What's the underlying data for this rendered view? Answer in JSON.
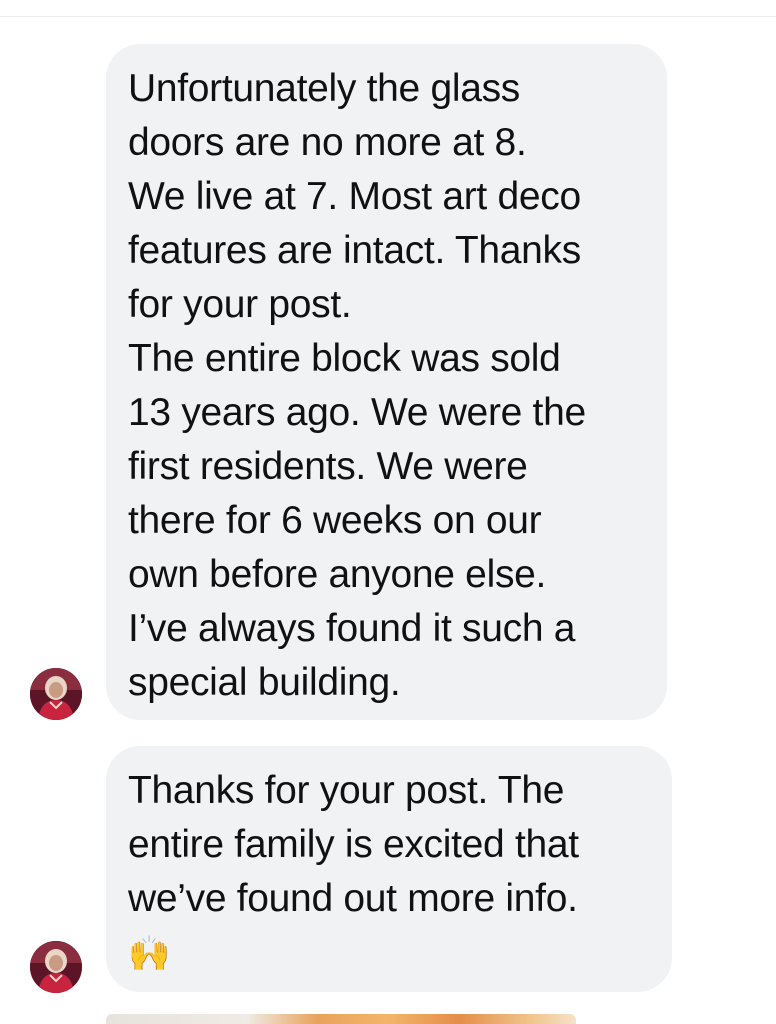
{
  "messages": [
    {
      "sender_avatar": "avatar-photo-woman",
      "lines": [
        "Unfortunately the glass",
        "doors are no more at 8.",
        "We live at 7. Most art deco",
        "features are intact. Thanks",
        "for your post.",
        "The entire block was sold",
        "13 years ago. We were the",
        "first residents. We were",
        "there for 6 weeks on our",
        "own before anyone else.",
        "I’ve always found it such a",
        "special building."
      ]
    },
    {
      "sender_avatar": "avatar-photo-woman",
      "lines": [
        "Thanks for your post. The",
        "entire family is excited that",
        "we’ve found out more info."
      ],
      "emoji": "🙌",
      "emoji_name": "raising-hands-icon"
    }
  ],
  "colors": {
    "bubble_background": "#f1f2f4",
    "text": "#111111",
    "page_background": "#ffffff"
  }
}
